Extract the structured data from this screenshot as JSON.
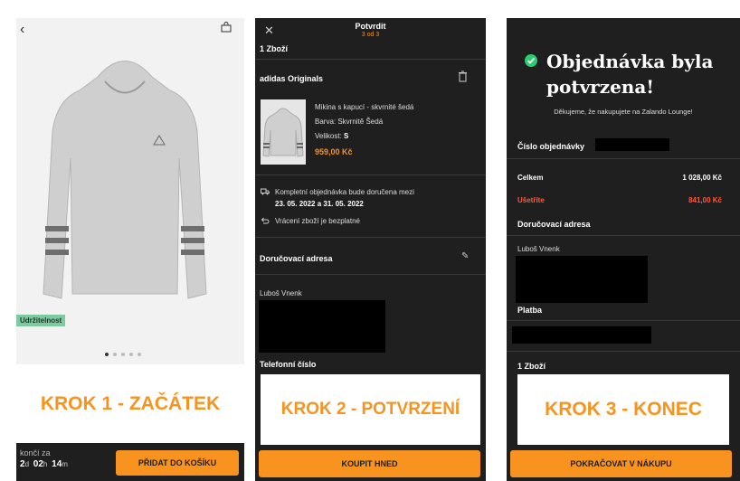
{
  "step1": {
    "badge": "Udržitelnost",
    "step_label": "KROK 1 - ZAČÁTEK",
    "timer_label": "končí za",
    "timer_d": "2",
    "timer_d_unit": "d",
    "timer_h": "02",
    "timer_h_unit": "h",
    "timer_m": "14",
    "timer_m_unit": "m",
    "cta": "PŘIDAT DO KOŠÍKU"
  },
  "step2": {
    "title": "Potvrdit",
    "subtitle": "3 od 3",
    "items_count": "1 Zboží",
    "brand": "adidas Originals",
    "product_name": "Mikina s kapucí - skvrnité šedá",
    "color": "Barva: Skvrnitě Šedá",
    "size_label": "Velikost:",
    "size_value": "S",
    "price": "959,00 Kč",
    "delivery_text": "Kompletní objednávka bude doručena mezi",
    "delivery_dates": "23. 05. 2022 a 31. 05. 2022",
    "returns_text": "Vrácení zboží je bezplatné",
    "address_title": "Doručovací adresa",
    "address_name": "Luboš Vnenk",
    "phone_title": "Telefonní číslo",
    "step_label": "KROK 2 - POTVRZENÍ",
    "cta": "KOUPIT HNED"
  },
  "step3": {
    "title": "Objednávka byla potvrzena!",
    "thanks": "Děkujeme, že nakupujete na Zalando Lounge!",
    "order_number_label": "Číslo objednávky",
    "total_label": "Celkem",
    "total_value": "1 028,00 Kč",
    "saved_label": "Ušetříte",
    "saved_value": "841,00 Kč",
    "address_title": "Doručovací adresa",
    "address_name": "Luboš Vnenk",
    "payment_title": "Platba",
    "items_count": "1 Zboží",
    "step_label": "KROK 3 - KONEC",
    "cta": "POKRAČOVAT V NÁKUPU"
  }
}
